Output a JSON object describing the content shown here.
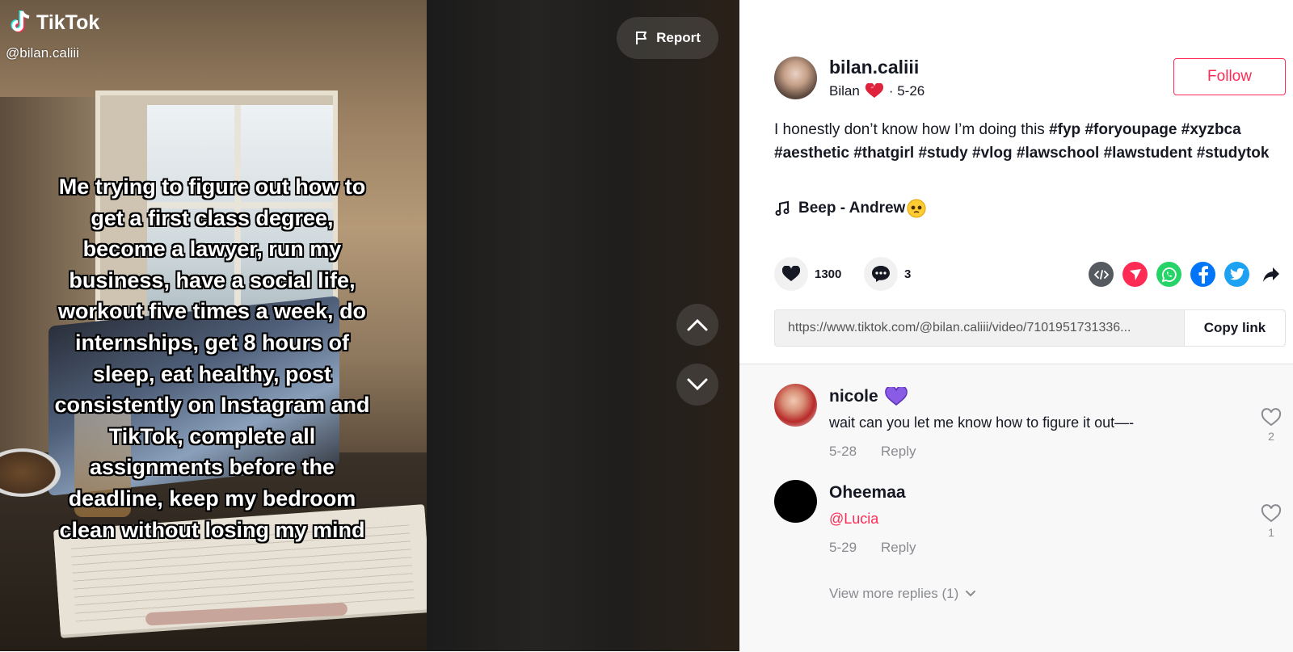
{
  "brand": {
    "logo_text": "TikTok",
    "accent": "#fe2c55"
  },
  "video": {
    "handle": "@bilan.caliii",
    "caption": "Me trying to figure out how to get a first class degree, become a lawyer, run my business, have a social life, workout five times a week, do internships, get 8 hours of sleep, eat healthy, post consistently on Instagram and TikTok, complete all assignments before the deadline, keep my bedroom clean without losing my mind",
    "report_label": "Report"
  },
  "author": {
    "username": "bilan.caliii",
    "nickname": "Bilan",
    "date": "· 5-26",
    "follow_label": "Follow"
  },
  "description": {
    "text": "I honestly don’t know how I’m doing this",
    "hashtags": [
      "#fyp",
      "#foryoupage",
      "#xyzbca",
      "#aesthetic",
      "#thatgirl",
      "#study",
      "#vlog",
      "#lawschool",
      "#lawstudent",
      "#studytok"
    ]
  },
  "music": {
    "title": "Beep - Andrew"
  },
  "stats": {
    "likes": "1300",
    "comments": "3"
  },
  "share": {
    "icons": [
      {
        "name": "embed-icon",
        "color": "#555a61"
      },
      {
        "name": "send-to-friends-icon",
        "color": "#fe2c55"
      },
      {
        "name": "whatsapp-icon",
        "color": "#25d366"
      },
      {
        "name": "facebook-icon",
        "color": "#0075fa"
      },
      {
        "name": "twitter-icon",
        "color": "#1da1f2"
      },
      {
        "name": "share-arrow-icon",
        "color": "#161823"
      }
    ],
    "link": "https://www.tiktok.com/@bilan.caliii/video/7101951731336...",
    "copy_label": "Copy link"
  },
  "comments": [
    {
      "author": "nicole",
      "text": "wait can you let me know how to figure it out—-",
      "date": "5-28",
      "reply_label": "Reply",
      "likes": "2"
    },
    {
      "author": "Oheemaa",
      "text": "@Lucia",
      "date": "5-29",
      "reply_label": "Reply",
      "likes": "1"
    }
  ],
  "view_more_replies": "View more replies (1)"
}
